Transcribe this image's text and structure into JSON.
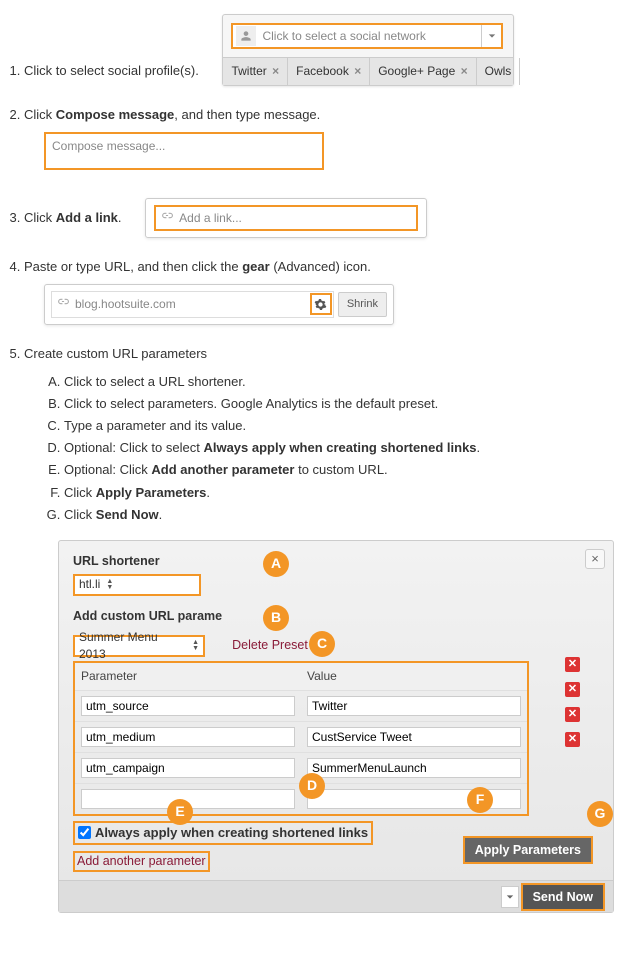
{
  "steps": {
    "s1": "Click to select social profile(s).",
    "s2a": "Click ",
    "s2b": "Compose message",
    "s2c": ", and then type message.",
    "s3a": "Click ",
    "s3b": "Add a link",
    "s3c": ".",
    "s4a": "Paste or type URL, and then click the ",
    "s4b": "gear",
    "s4c": " (Advanced) icon.",
    "s5": "Create custom URL parameters"
  },
  "social": {
    "placeholder": "Click to select a social network",
    "tabs": [
      "Twitter",
      "Facebook",
      "Google+ Page",
      "Owls"
    ]
  },
  "compose_ph": "Compose message...",
  "link_ph": "Add a link...",
  "url_val": "blog.hootsuite.com",
  "shrink": "Shrink",
  "sub": {
    "a": "Click to select a URL shortener.",
    "b": "Click to select parameters. Google Analytics is the default preset.",
    "c": "Type a parameter and its value.",
    "d1": "Optional: Click to select ",
    "d2": "Always apply when creating shortened links",
    "d3": ".",
    "e1": "Optional: Click ",
    "e2": "Add another parameter",
    "e3": " to custom URL.",
    "f1": "Click ",
    "f2": "Apply Parameters",
    "f3": ".",
    "g1": "Click ",
    "g2": "Send Now",
    "g3": "."
  },
  "panel": {
    "url_shortener_label": "URL shortener",
    "shortener_val": "htl.li",
    "params_label": "Add custom URL parame",
    "preset_val": "Summer Menu 2013",
    "reset": "Delete Preset",
    "col_param": "Parameter",
    "col_value": "Value",
    "rows": [
      {
        "p": "utm_source",
        "v": "Twitter"
      },
      {
        "p": "utm_medium",
        "v": "CustService Tweet"
      },
      {
        "p": "utm_campaign",
        "v": "SummerMenuLaunch"
      },
      {
        "p": "",
        "v": ""
      }
    ],
    "always": "Always apply when creating shortened links",
    "add_param": "Add another parameter",
    "apply": "Apply Parameters",
    "send": "Send Now"
  },
  "badges": {
    "a": "A",
    "b": "B",
    "c": "C",
    "d": "D",
    "e": "E",
    "f": "F",
    "g": "G"
  }
}
